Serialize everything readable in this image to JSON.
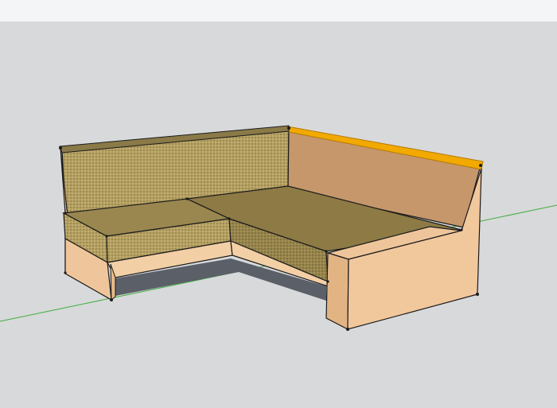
{
  "viewport": {
    "sky_color": "#f4f5f6",
    "ground_color": "#d8d9da",
    "green_axis_color": "#3fae3f",
    "selection_color": "#f2a900"
  },
  "model": {
    "name": "corner-sofa",
    "selected_edge": "right-backrest-top",
    "material_colors": {
      "fabric": "#b09b5c",
      "fabric_dark": "#8d7a44",
      "wood_light": "#f1c89d",
      "wood_mid": "#e8b884",
      "wood_shade": "#c9966a",
      "shadow": "#5a5e66",
      "edge": "#1b1b1b"
    }
  }
}
